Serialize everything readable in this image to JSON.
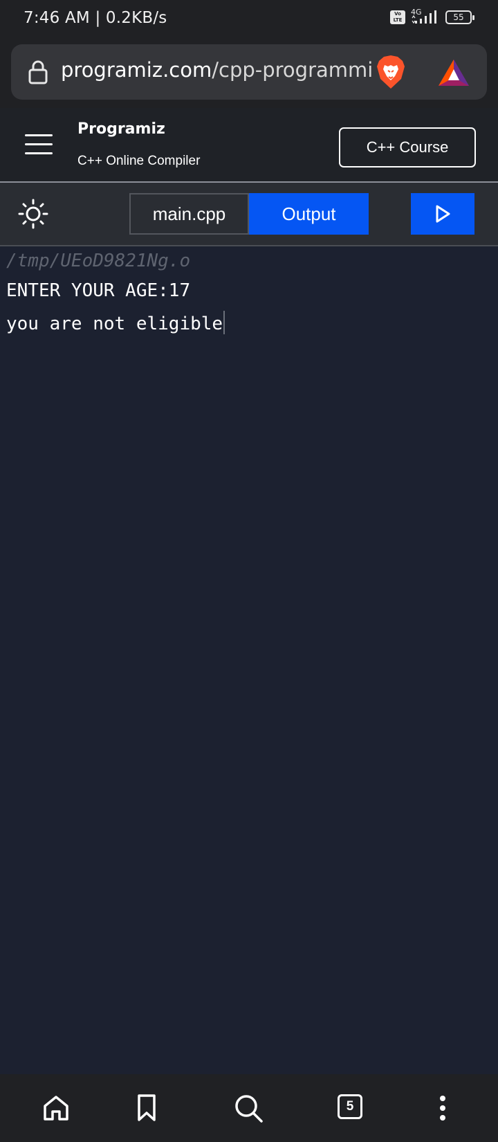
{
  "status_bar": {
    "time": "7:46 AM | 0.2KB/s",
    "volte": "Vo LTE",
    "network": "4G",
    "battery": "55"
  },
  "browser": {
    "url": "programiz.com/cpp-programming",
    "url_domain": "programiz.com",
    "url_path": "/cpp-programming"
  },
  "header": {
    "logo": "Programiz",
    "subtitle": "C++ Online Compiler",
    "course_button": "C++ Course"
  },
  "toolbar": {
    "file_tab": "main.cpp",
    "output_tab": "Output"
  },
  "console": {
    "path": "/tmp/UEoD9821Ng.o",
    "lines": [
      "ENTER YOUR AGE:17",
      "you are not eligible"
    ]
  },
  "bottom_nav": {
    "tabs_count": "5"
  },
  "colors": {
    "accent_blue": "#0556f3",
    "console_bg": "#1c2130",
    "header_bg": "#1f2227"
  }
}
